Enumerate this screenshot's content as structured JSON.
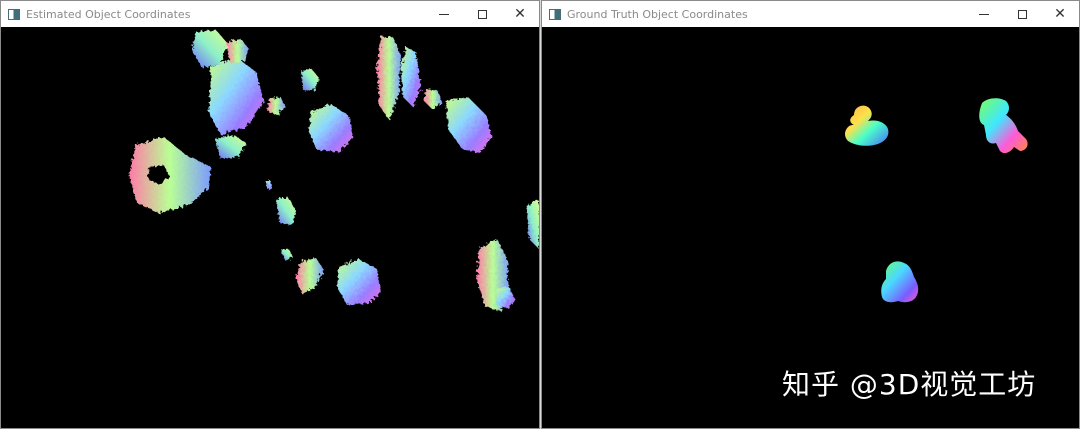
{
  "windows": [
    {
      "title": "Estimated Object Coordinates"
    },
    {
      "title": "Ground Truth Object Coordinates"
    }
  ],
  "controls": {
    "minimize": "minimize",
    "maximize": "maximize",
    "close": "close"
  },
  "watermark": "知乎 @3D视觉工坊"
}
